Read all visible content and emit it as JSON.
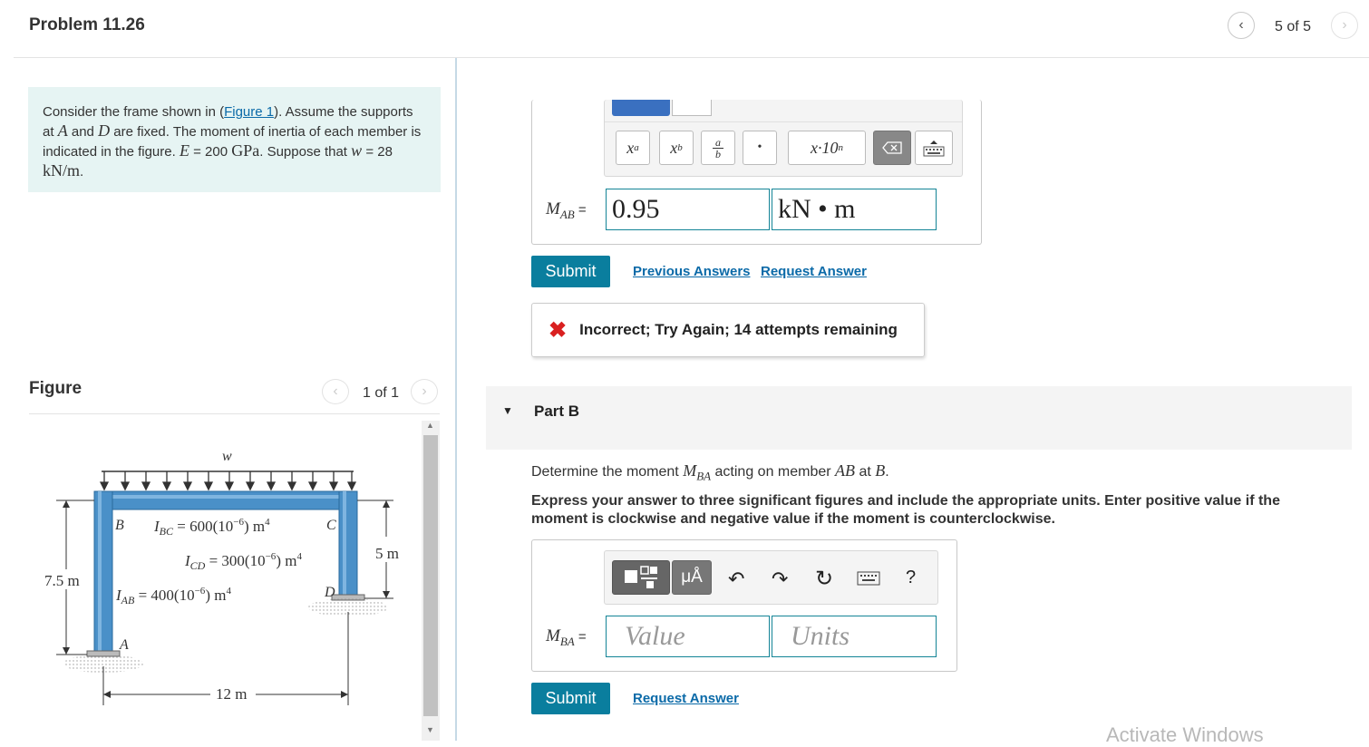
{
  "header": {
    "title": "Problem 11.26",
    "pager": "5 of 5"
  },
  "problem": {
    "text_1": "Consider the frame shown in (",
    "figure_link": "Figure 1",
    "text_2": "). Assume the supports at ",
    "var_A": "A",
    "text_3": " and ",
    "var_D": "D",
    "text_4": " are fixed. The moment of inertia of each member is indicated in the figure. ",
    "var_E": "E",
    "text_5": " = 200 ",
    "unit_E": "GPa",
    "text_6": ". Suppose that ",
    "var_w": "w",
    "text_7": " = 28 ",
    "unit_w": "kN/m",
    "text_8": "."
  },
  "figure": {
    "title": "Figure",
    "pager": "1 of 1",
    "labels": {
      "w": "w",
      "B": "B",
      "C": "C",
      "D": "D",
      "A": "A",
      "ibc": "I",
      "ibc_sub": "BC",
      "ibc_val": " = 600(10",
      "icd": "I",
      "icd_sub": "CD",
      "icd_val": " = 300(10",
      "iab": "I",
      "iab_sub": "AB",
      "iab_val": " = 400(10",
      "exp": "−6",
      "m4": ") m",
      "four": "4",
      "dim_left": "7.5 m",
      "dim_right": "5 m",
      "dim_bottom": "12 m"
    }
  },
  "part_a": {
    "toolbar": {
      "xa": "x",
      "xa_sup": "a",
      "xb": "x",
      "xb_sub": "b",
      "frac_top": "a",
      "frac_bot": "b",
      "dot": "•",
      "sci": "x·10",
      "sci_sup": "n"
    },
    "label": "M",
    "label_sub": "AB",
    "eq": "=",
    "value": "0.95",
    "units": "kN • m",
    "submit": "Submit",
    "prev_answers": "Previous Answers",
    "request_answer": "Request Answer",
    "feedback": "Incorrect; Try Again; 14 attempts remaining"
  },
  "part_b": {
    "title": "Part B",
    "question_1": "Determine the moment ",
    "q_var": "M",
    "q_sub": "BA",
    "question_2": " acting on member ",
    "q_member": "AB",
    "question_3": " at ",
    "q_point": "B",
    "question_4": ".",
    "instructions": "Express your answer to three significant figures and include the appropriate units. Enter positive value if the moment is clockwise and negative value if the moment is counterclockwise.",
    "toolbar": {
      "mu": "μÅ",
      "help": "?"
    },
    "label": "M",
    "label_sub": "BA",
    "eq": "=",
    "value_placeholder": "Value",
    "units_placeholder": "Units",
    "submit": "Submit",
    "request_answer": "Request Answer"
  },
  "watermark": "Activate Windows",
  "colors": {
    "accent": "#0a7e9e",
    "problem_bg": "#e6f4f3",
    "frame_blue": "#4a90c8",
    "error_red": "#d92020"
  }
}
